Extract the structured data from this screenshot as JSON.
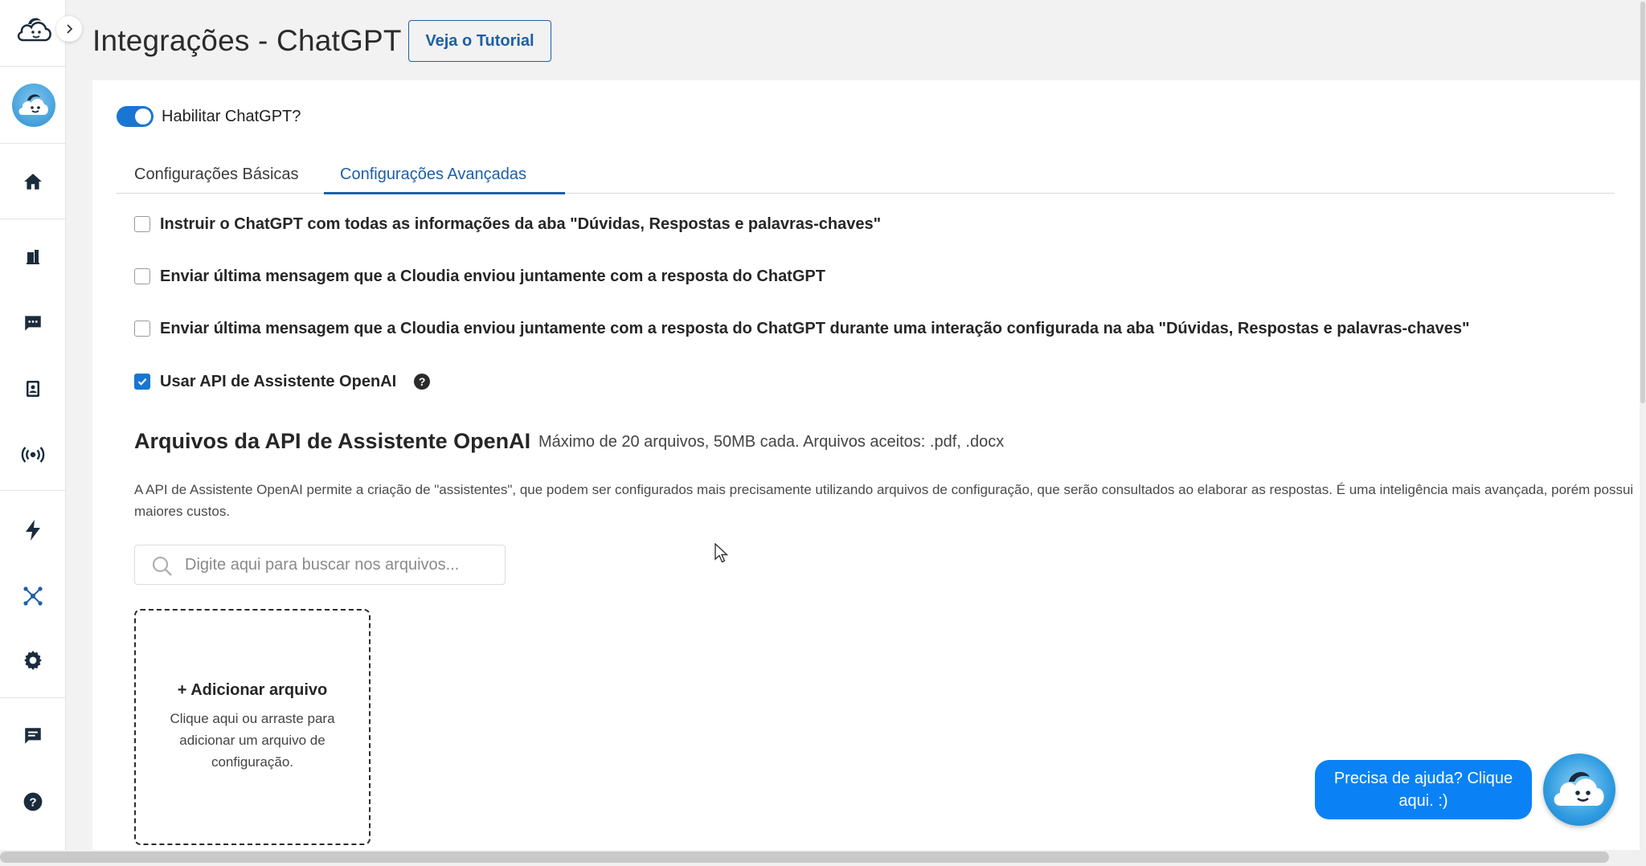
{
  "header": {
    "title": "Integrações - ChatGPT",
    "tutorial_button": "Veja o Tutorial"
  },
  "sidebar": {
    "items": [
      {
        "icon": "home-icon"
      },
      {
        "icon": "bar-chart-icon"
      },
      {
        "icon": "chat-icon"
      },
      {
        "icon": "contacts-icon"
      },
      {
        "icon": "broadcast-icon"
      },
      {
        "icon": "lightning-icon"
      },
      {
        "icon": "integrations-icon"
      },
      {
        "icon": "settings-icon"
      },
      {
        "icon": "message-icon"
      },
      {
        "icon": "help-icon"
      }
    ],
    "accent": "#1a2b3c"
  },
  "toggle": {
    "label": "Habilitar ChatGPT?",
    "enabled": true
  },
  "tabs": [
    {
      "label": "Configurações Básicas",
      "active": false
    },
    {
      "label": "Configurações Avançadas",
      "active": true
    }
  ],
  "options": [
    {
      "label": "Instruir o ChatGPT com todas as informações da aba \"Dúvidas, Respostas e palavras-chaves\"",
      "checked": false
    },
    {
      "label": "Enviar última mensagem que a Cloudia enviou juntamente com a resposta do ChatGPT",
      "checked": false
    },
    {
      "label": "Enviar última mensagem que a Cloudia enviou juntamente com a resposta do ChatGPT durante uma interação configurada na aba \"Dúvidas, Respostas e palavras-chaves\"",
      "checked": false
    },
    {
      "label": "Usar API de Assistente OpenAI",
      "checked": true
    }
  ],
  "files_section": {
    "title": "Arquivos da API de Assistente OpenAI",
    "subtitle": "Máximo de 20 arquivos, 50MB cada. Arquivos aceitos: .pdf, .docx",
    "description": "A API de Assistente OpenAI permite a criação de \"assistentes\", que podem ser configurados mais precisamente utilizando arquivos de configuração, que serão consultados ao elaborar as respostas. É uma inteligência mais avançada, porém possui maiores custos.",
    "search_placeholder": "Digite aqui para buscar nos arquivos...",
    "add_title": "+ Adicionar arquivo",
    "add_text": "Clique aqui ou arraste para adicionar um arquivo de configuração."
  },
  "help": {
    "bubble": "Precisa de ajuda? Clique aqui. :)"
  },
  "colors": {
    "accent": "#1976d2",
    "primary_text": "#1e5fa8",
    "help_bubble": "#0a82f5"
  }
}
